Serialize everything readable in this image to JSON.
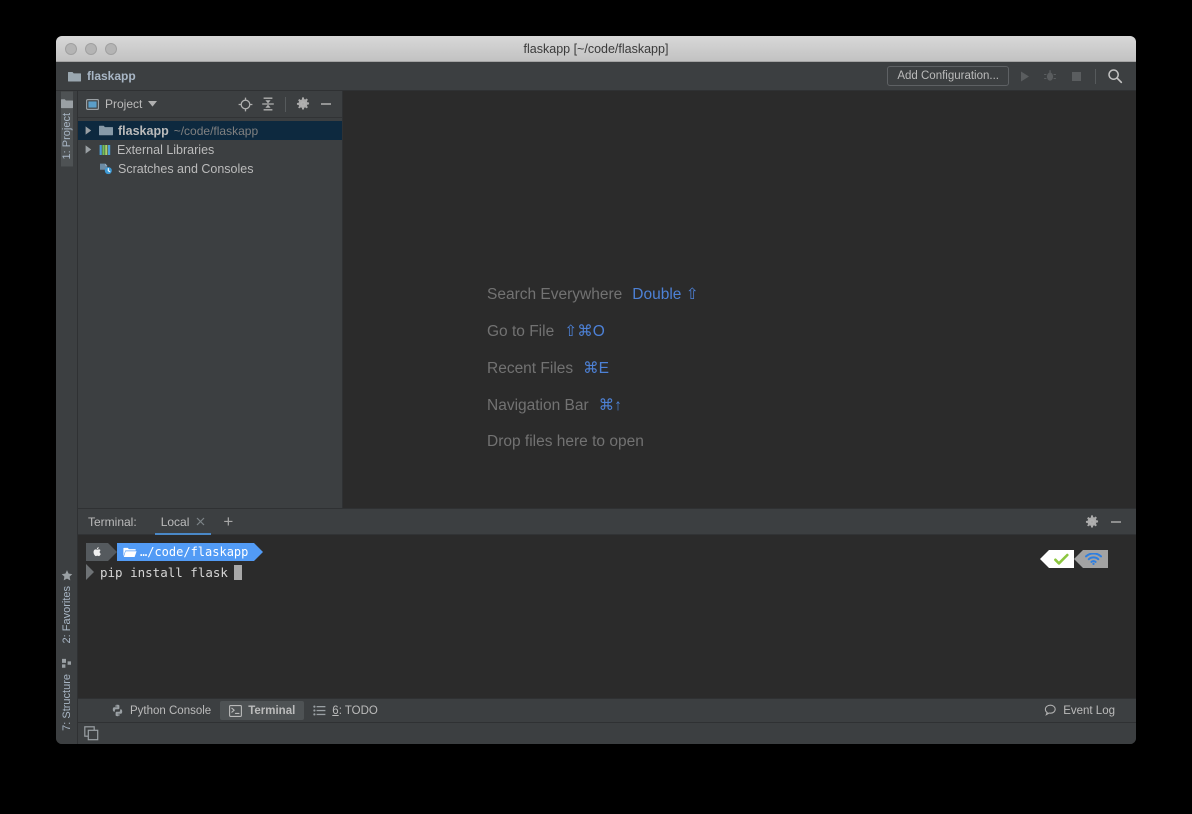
{
  "window": {
    "title": "flaskapp [~/code/flaskapp]",
    "traffic_lights": [
      "close",
      "minimize",
      "zoom"
    ]
  },
  "toolbar": {
    "breadcrumb": "flaskapp",
    "breadcrumb_icon": "folder-icon",
    "add_configuration_label": "Add Configuration...",
    "run_icon": "run-icon",
    "debug_icon": "debug-icon",
    "stop_icon": "stop-icon",
    "search_icon": "search-icon"
  },
  "left_strip": {
    "tabs": [
      {
        "label": "1: Project",
        "icon": "folder-icon",
        "active": true
      },
      {
        "label": "2: Favorites",
        "icon": "star-icon",
        "active": false
      },
      {
        "label": "7: Structure",
        "icon": "structure-icon",
        "active": false
      }
    ]
  },
  "project_panel": {
    "title": "Project",
    "title_icon": "project-icon",
    "dropdown_icon": "chevron-down-icon",
    "locate_icon": "target-icon",
    "collapse_icon": "collapse-all-icon",
    "settings_icon": "gear-icon",
    "hide_icon": "minimize-icon",
    "tree": [
      {
        "name": "flaskapp",
        "sub": "~/code/flaskapp",
        "icon": "folder-icon",
        "expandable": true,
        "selected": true,
        "indent": 0
      },
      {
        "name": "External Libraries",
        "sub": "",
        "icon": "library-icon",
        "expandable": true,
        "selected": false,
        "indent": 0
      },
      {
        "name": "Scratches and Consoles",
        "sub": "",
        "icon": "scratches-icon",
        "expandable": false,
        "selected": false,
        "indent": 0
      }
    ]
  },
  "editor": {
    "hints": [
      {
        "label": "Search Everywhere",
        "key": "Double ⇧"
      },
      {
        "label": "Go to File",
        "key": "⇧⌘O"
      },
      {
        "label": "Recent Files",
        "key": "⌘E"
      },
      {
        "label": "Navigation Bar",
        "key": "⌘↑"
      }
    ],
    "drop_hint": "Drop files here to open"
  },
  "terminal": {
    "label": "Terminal:",
    "tab_label": "Local",
    "tab_close_icon": "close-icon",
    "add_icon": "plus-icon",
    "settings_icon": "gear-icon",
    "hide_icon": "minimize-icon",
    "prompt": {
      "os_icon": "apple-icon",
      "dir_icon": "folder-open-icon",
      "path": "…/code/flaskapp"
    },
    "command": "pip install flask",
    "right_prompt": {
      "status_icon": "check-icon",
      "network_icon": "wifi-icon"
    }
  },
  "status_bar": {
    "items": [
      {
        "label": "Python Console",
        "icon": "python-icon",
        "active": false
      },
      {
        "label": "Terminal",
        "icon": "terminal-icon",
        "active": true
      },
      {
        "label": "6: TODO",
        "icon": "todo-icon",
        "active": false,
        "underline": "6"
      }
    ],
    "event_log": {
      "label": "Event Log",
      "icon": "balloon-icon"
    }
  },
  "bottom_bar": {
    "layout_icon": "windows-layout-icon"
  },
  "colors": {
    "panel_bg": "#3c3f41",
    "editor_bg": "#2b2b2b",
    "accent_blue": "#4d81d6",
    "selection": "#0d293f",
    "text": "#bbbbbb",
    "muted_text": "#808080",
    "prompt_blue": "#529bf5",
    "check_green": "#8cc63f"
  }
}
